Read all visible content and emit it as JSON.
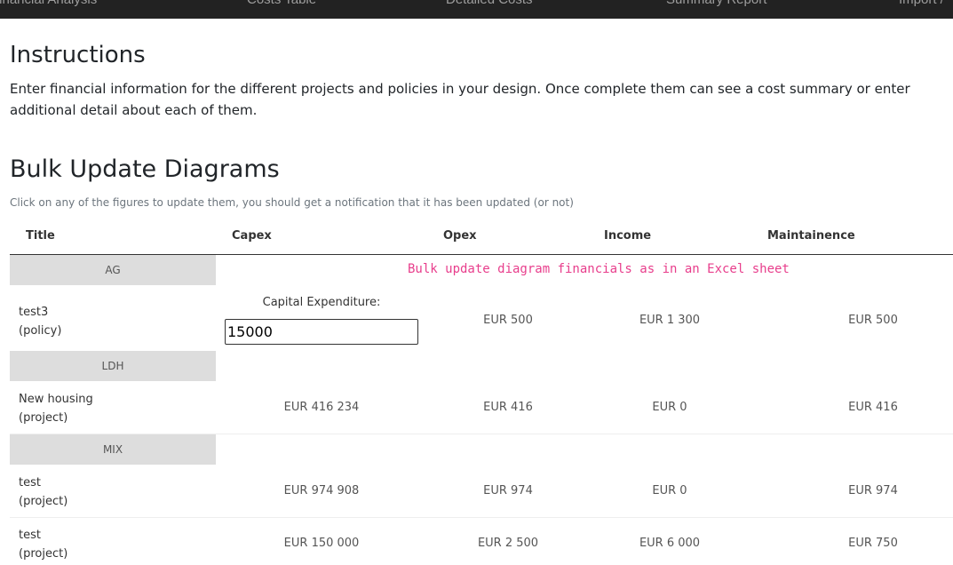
{
  "nav": {
    "items": [
      "Financial Analysis",
      "Costs Table",
      "Detailed Costs",
      "Summary Report",
      "Import /"
    ]
  },
  "instructions": {
    "title": "Instructions",
    "text": "Enter financial information for the different projects and policies in your design. Once complete them can see a cost summary or enter additional detail about each of them."
  },
  "bulk": {
    "title": "Bulk Update Diagrams",
    "hint": "Click on any of the figures to update them, you should get a notification that it has been updated (or not)",
    "note": "Bulk update diagram financials as in an Excel sheet"
  },
  "table": {
    "headers": [
      "Title",
      "Capex",
      "Opex",
      "Income",
      "Maintainence"
    ],
    "groups": [
      "AG",
      "LDH",
      "MIX"
    ],
    "rows": [
      {
        "name": "test3",
        "type": "(policy)",
        "capex": "",
        "opex": "EUR 500",
        "income": "EUR 1 300",
        "maint": "EUR 500"
      },
      {
        "name": "New housing",
        "type": "(project)",
        "capex": "EUR 416 234",
        "opex": "EUR 416",
        "income": "EUR 0",
        "maint": "EUR 416"
      },
      {
        "name": "test",
        "type": "(project)",
        "capex": "EUR 974 908",
        "opex": "EUR 974",
        "income": "EUR 0",
        "maint": "EUR 974"
      },
      {
        "name": "test",
        "type": "(project)",
        "capex": "EUR 150 000",
        "opex": "EUR 2 500",
        "income": "EUR 6 000",
        "maint": "EUR 750"
      }
    ],
    "capex_editor": {
      "label": "Capital Expenditure:",
      "value": "15000"
    }
  },
  "colors": {
    "navbar": "#222222",
    "note": "#e83e8c",
    "group_bg": "#dddddd"
  }
}
